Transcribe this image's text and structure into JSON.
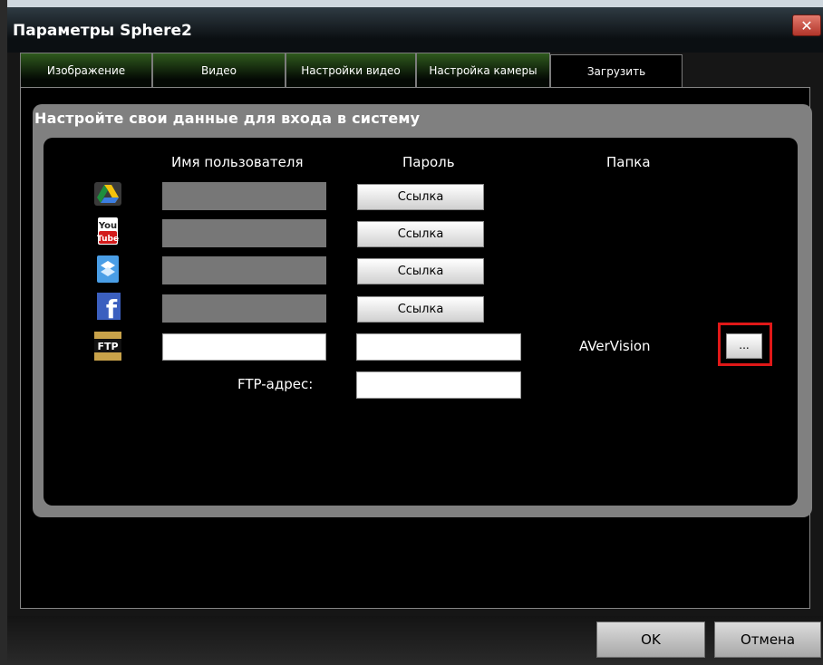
{
  "window": {
    "title": "Параметры Sphere2",
    "close_glyph": "✕"
  },
  "tabs": [
    {
      "label": "Изображение"
    },
    {
      "label": "Видео"
    },
    {
      "label": "Настройки видео"
    },
    {
      "label": "Настройка камеры"
    },
    {
      "label": "Загрузить",
      "active": true
    }
  ],
  "section": {
    "title": "Настройте свои данные для входа в систему",
    "headers": {
      "username": "Имя пользователя",
      "password": "Пароль",
      "folder": "Папка"
    }
  },
  "services": [
    {
      "icon": "google-drive-icon",
      "link_label": "Ссылка"
    },
    {
      "icon": "youtube-icon",
      "link_label": "Ссылка",
      "icon_text_top": "You",
      "icon_text_bottom": "Tube"
    },
    {
      "icon": "dropbox-icon",
      "link_label": "Ссылка"
    },
    {
      "icon": "facebook-icon",
      "link_label": "Ссылка",
      "icon_text": "f"
    },
    {
      "icon": "ftp-icon",
      "icon_text": "FTP",
      "username": "",
      "password": "",
      "folder": "AVerVision",
      "browse_label": "..."
    }
  ],
  "ftp": {
    "address_label": "FTP-адрес:",
    "address": ""
  },
  "buttons": {
    "ok": "OK",
    "cancel": "Отмена"
  },
  "colors": {
    "tab_green": "#2f5a1d",
    "highlight": "#e01818",
    "disabled_field": "#777777"
  }
}
